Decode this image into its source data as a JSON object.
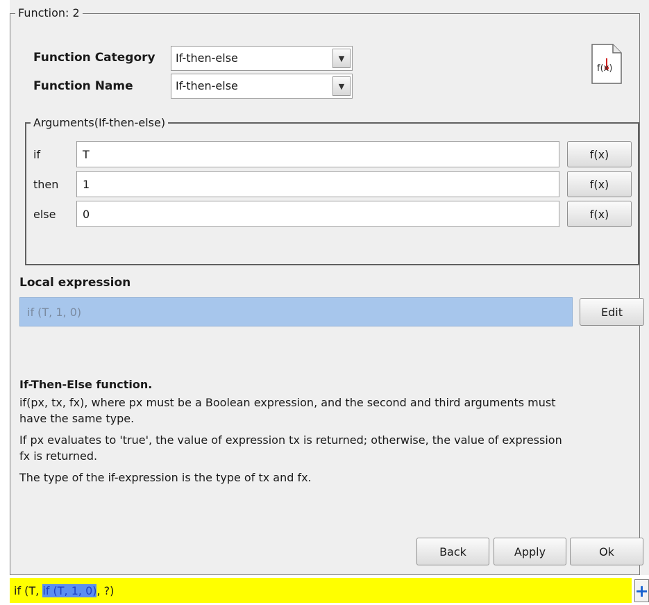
{
  "function_group": {
    "legend": "Function: 2"
  },
  "category": {
    "label": "Function Category",
    "value": "If-then-else"
  },
  "name": {
    "label": "Function Name",
    "value": "If-then-else"
  },
  "fx_icon_text": "f(x)",
  "arguments": {
    "legend": "Arguments(If-then-else)",
    "rows": [
      {
        "label": "if",
        "value": "T",
        "button": "f(x)"
      },
      {
        "label": "then",
        "value": "1",
        "button": "f(x)"
      },
      {
        "label": "else",
        "value": "0",
        "button": "f(x)"
      }
    ]
  },
  "local_expression": {
    "label": "Local expression",
    "value": "if (T, 1, 0)",
    "edit_label": "Edit"
  },
  "description": {
    "title": "If-Then-Else function.",
    "lines": [
      "if(px, tx, fx), where px must be a Boolean expression, and the second and third arguments must",
      "have the same type.",
      "If px evaluates to 'true', the value of expression tx is returned; otherwise, the value of expression",
      "fx is returned.",
      "The type of the if-expression is the type of tx and fx."
    ]
  },
  "buttons": {
    "back": "Back",
    "apply": "Apply",
    "ok": "Ok"
  },
  "status": {
    "prefix": "if (T, ",
    "highlight": "if (T, 1, 0)",
    "suffix": ", ?)"
  },
  "plus_label": "+",
  "colors": {
    "status_bg": "#ffff00",
    "expr_bg": "#a7c6ec",
    "highlight": "#5b8ef0"
  }
}
